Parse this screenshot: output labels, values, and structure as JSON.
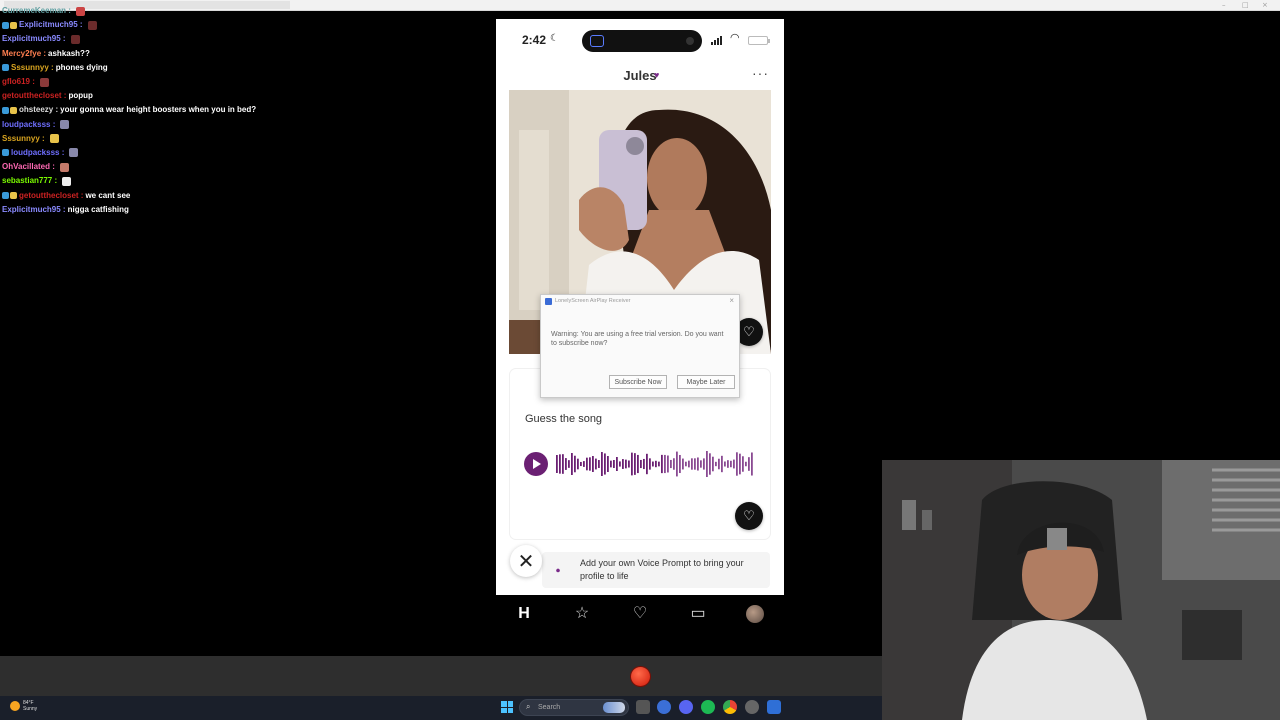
{
  "chat": {
    "messages": [
      {
        "user": "CurremeKeeman",
        "text": "",
        "color": "#5f9ea0",
        "emote": "#c44"
      },
      {
        "user": "Explicitmuch95",
        "text": "",
        "color": "#8a8aff",
        "emote": "#6b2b2b"
      },
      {
        "user": "Explicitmuch95",
        "text": "",
        "color": "#8a8aff",
        "emote": "#6b2b2b"
      },
      {
        "user": "Mercy2fye",
        "text": "ashkash??",
        "color": "#ff7f50",
        "emote": ""
      },
      {
        "user": "Sssunnyy",
        "text": "phones dying",
        "color": "#daa520",
        "emote": ""
      },
      {
        "user": "gflo619",
        "text": "",
        "color": "#cc2222",
        "emote": "#8b3a3a"
      },
      {
        "user": "getoutthecloset",
        "text": "popup",
        "color": "#cc2222",
        "emote": ""
      },
      {
        "user": "ohsteezy",
        "text": "your gonna wear height boosters when you in bed?",
        "color": "#dddddd",
        "emote": ""
      },
      {
        "user": "loudpacksss",
        "text": "",
        "color": "#6f6fff",
        "emote": "#8888aa"
      },
      {
        "user": "Sssunnyy",
        "text": "",
        "color": "#daa520",
        "emote": "#e8c34a"
      },
      {
        "user": "loudpacksss",
        "text": "",
        "color": "#6f6fff",
        "emote": "#8888aa"
      },
      {
        "user": "OhVacillated",
        "text": "",
        "color": "#ff69b4",
        "emote": "#c47a6a"
      },
      {
        "user": "sebastian777",
        "text": "",
        "color": "#7cfc00",
        "emote": "#eeeeee"
      },
      {
        "user": "getoutthecloset",
        "text": "we cant see",
        "color": "#cc2222",
        "emote": ""
      },
      {
        "user": "Explicitmuch95",
        "text": "nigga catfishing",
        "color": "#8a8aff",
        "emote": ""
      }
    ]
  },
  "phone": {
    "status": {
      "time": "2:42",
      "moon": "☾",
      "wifi": "◠"
    },
    "profile": {
      "name": "Jules",
      "verified_icon": "♥",
      "more": "···"
    },
    "photo": {
      "like_icon": "♡"
    },
    "voice_card": {
      "title": "Guess the song",
      "like_icon": "♡"
    },
    "prompt": {
      "text": "Add your own Voice Prompt to bring your profile to life",
      "close_icon": "✕",
      "mic_icon": "⏺"
    },
    "tabs": [
      {
        "name": "home",
        "icon": "H"
      },
      {
        "name": "standouts",
        "icon": "☆"
      },
      {
        "name": "likes",
        "icon": "♡"
      },
      {
        "name": "messages",
        "icon": "▭"
      },
      {
        "name": "profile",
        "icon": ""
      }
    ]
  },
  "dialog": {
    "title": "LonelyScreen AirPlay Receiver",
    "message": "Warning: You are using a free trial version. Do you want to subscribe now?",
    "subscribe_label": "Subscribe Now",
    "later_label": "Maybe Later",
    "close": "×"
  },
  "taskbar": {
    "weather_temp": "84°F",
    "weather_desc": "Sunny",
    "search_placeholder": "Search",
    "search_icon": "⌕"
  },
  "colors": {
    "accent": "#6b2073",
    "rec": "#d01a0a"
  }
}
